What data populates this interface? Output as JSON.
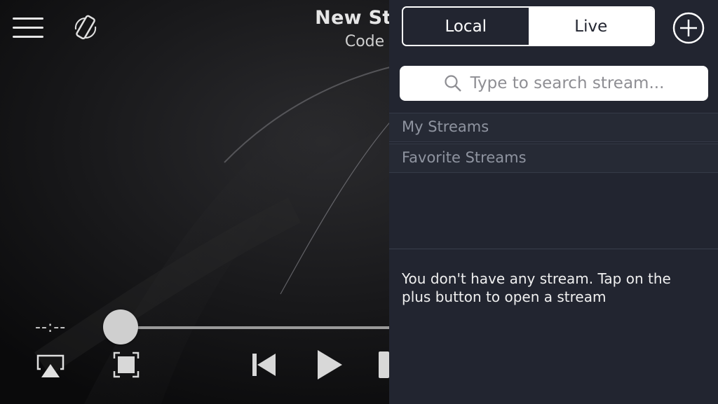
{
  "player": {
    "title": "New Stre",
    "subtitle": "Code",
    "time": "--:--",
    "progress": 0,
    "icons": {
      "menu": "hamburger-menu-icon",
      "rotate": "rotate-device-icon",
      "airplay": "airplay-icon",
      "fullscreen": "fullscreen-icon",
      "previous": "skip-previous-icon",
      "play": "play-icon",
      "stop": "stop-icon"
    }
  },
  "panel": {
    "tabs": [
      {
        "label": "Local",
        "selected": false
      },
      {
        "label": "Live",
        "selected": true
      }
    ],
    "add_icon": "plus-circle-icon",
    "search": {
      "placeholder": "Type to search stream..."
    },
    "sections": [
      {
        "label": "My Streams"
      },
      {
        "label": "Favorite Streams"
      }
    ],
    "empty_message": "You don't have any stream. Tap on the plus button to open a stream"
  },
  "colors": {
    "panel_bg": "#222530",
    "player_bg": "#0c0c0d",
    "section_text": "#8f94a0",
    "accent_white": "#ffffff"
  }
}
